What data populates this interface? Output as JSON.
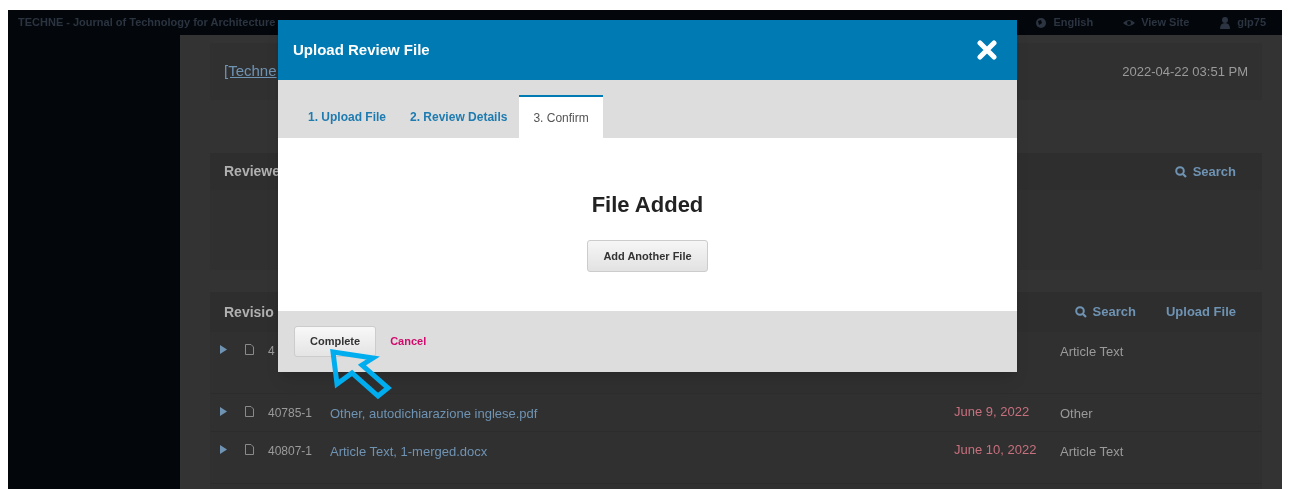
{
  "top_bar": {
    "site_title": "TECHNE - Journal of Technology for Architecture",
    "links": [
      {
        "kind": "language",
        "label": "English"
      },
      {
        "kind": "view",
        "label": "View Site"
      },
      {
        "kind": "user",
        "label": "glp75"
      }
    ]
  },
  "header": {
    "link": "[Techne",
    "date": "2022-04-22 03:51 PM"
  },
  "reviewers_panel": {
    "title": "Reviewe",
    "actions": [
      {
        "kind": "search",
        "label": "Search"
      }
    ]
  },
  "revisions_panel": {
    "title": "Revisio",
    "actions": [
      {
        "kind": "search",
        "label": "Search"
      },
      {
        "kind": "upload",
        "label": "Upload File"
      }
    ],
    "rows": [
      {
        "id": "4",
        "type": "Article Text"
      },
      {
        "id": "40785-1",
        "name": "Other, autodichiarazione inglese.pdf",
        "date": "June 9, 2022",
        "type": "Other"
      },
      {
        "id": "40807-1",
        "name": "Article Text, 1-merged.docx",
        "date": "June 10, 2022",
        "type": "Article Text"
      }
    ]
  },
  "modal": {
    "title": "Upload Review File",
    "tabs": [
      {
        "label": "1. Upload File",
        "selected": false
      },
      {
        "label": "2. Review Details",
        "selected": false
      },
      {
        "label": "3. Confirm",
        "selected": true
      }
    ],
    "heading": "File Added",
    "add_button": "Add Another File",
    "buttons": [
      {
        "kind": "primary",
        "label": "Complete"
      },
      {
        "kind": "cancel",
        "label": "Cancel"
      }
    ]
  }
}
